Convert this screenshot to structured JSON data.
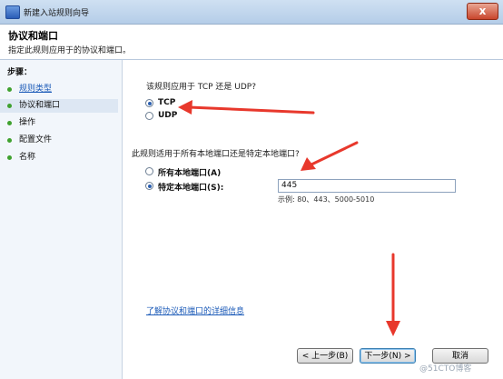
{
  "window": {
    "title": "新建入站规则向导",
    "close_glyph": "x"
  },
  "header": {
    "title": "协议和端口",
    "subtitle": "指定此规则应用于的协议和端口。"
  },
  "sidebar": {
    "steps_label": "步骤：",
    "items": [
      {
        "label": "规则类型",
        "state": "done"
      },
      {
        "label": "协议和端口",
        "state": "current"
      },
      {
        "label": "操作",
        "state": "pending"
      },
      {
        "label": "配置文件",
        "state": "pending"
      },
      {
        "label": "名称",
        "state": "pending"
      }
    ]
  },
  "main": {
    "protocol_question": "该规则应用于 TCP 还是 UDP?",
    "protocols": [
      {
        "label": "TCP",
        "selected": true
      },
      {
        "label": "UDP",
        "selected": false
      }
    ],
    "port_question": "此规则适用于所有本地端口还是特定本地端口?",
    "ports": [
      {
        "label": "所有本地端口(A)",
        "selected": false
      },
      {
        "label": "特定本地端口(S):",
        "selected": true
      }
    ],
    "port_value": "445",
    "example": "示例: 80、443、5000-5010",
    "learn_link": "了解协议和端口的详细信息"
  },
  "buttons": {
    "back": "< 上一步(B)",
    "next": "下一步(N) >",
    "cancel": "取消"
  },
  "colors": {
    "arrow": "#e8382c",
    "link": "#1c5bb8",
    "step_dot": "#3fa12f"
  },
  "watermark": "@51CTO博客"
}
